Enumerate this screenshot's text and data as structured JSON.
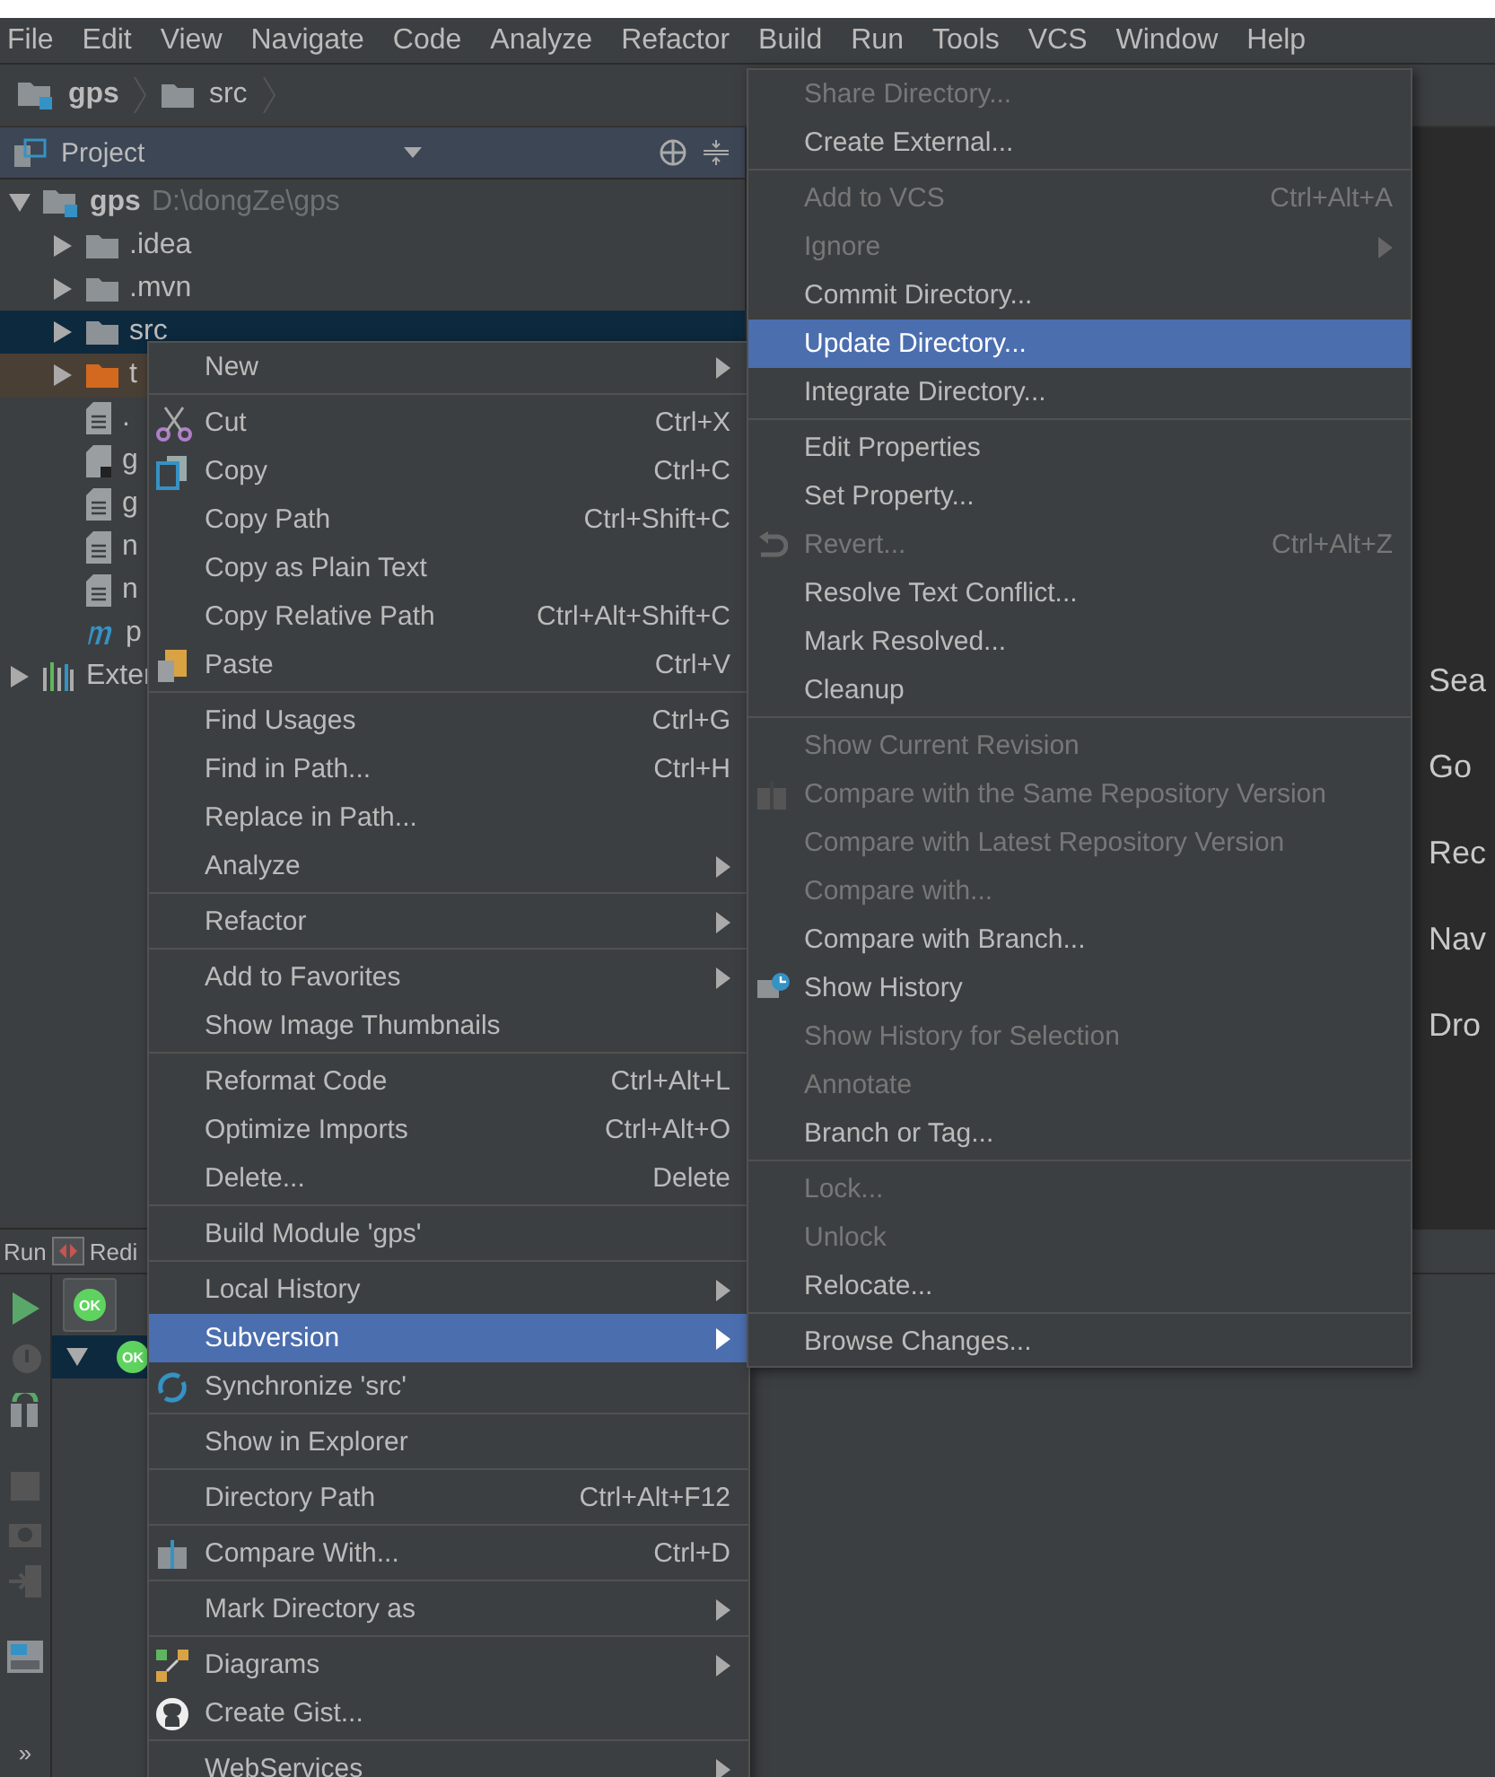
{
  "menu_bar": [
    "File",
    "Edit",
    "View",
    "Navigate",
    "Code",
    "Analyze",
    "Refactor",
    "Build",
    "Run",
    "Tools",
    "VCS",
    "Window",
    "Help"
  ],
  "breadcrumb": [
    {
      "label": "gps",
      "kind": "module"
    },
    {
      "label": "src",
      "kind": "folder"
    }
  ],
  "project_panel": {
    "title": "Project",
    "tree": [
      {
        "label": "gps",
        "path": "D:\\dongZe\\gps",
        "kind": "module",
        "expanded": true,
        "selected": false,
        "children": [
          {
            "label": ".idea",
            "kind": "folder",
            "expanded": false,
            "selected": false
          },
          {
            "label": ".mvn",
            "kind": "folder",
            "expanded": false,
            "selected": false
          },
          {
            "label": "src",
            "kind": "folder",
            "expanded": false,
            "selected": true
          },
          {
            "label": "t",
            "kind": "excluded",
            "expanded": false,
            "selected": false
          },
          {
            "label": ".",
            "kind": "file",
            "selected": false
          },
          {
            "label": "g",
            "kind": "script",
            "selected": false
          },
          {
            "label": "g",
            "kind": "file",
            "selected": false
          },
          {
            "label": "n",
            "kind": "file",
            "selected": false
          },
          {
            "label": "n",
            "kind": "file",
            "selected": false
          },
          {
            "label": "p",
            "kind": "maven",
            "selected": false
          }
        ]
      },
      {
        "label": "Exter",
        "kind": "library",
        "expanded": false,
        "selected": false
      }
    ]
  },
  "editor_hints": [
    "Sea",
    "Go",
    "Rec",
    "Nav",
    "Dro"
  ],
  "run_panel": {
    "tabs": [
      "Run",
      "Redi"
    ],
    "badges": [
      "OK",
      "OK"
    ],
    "more": "»"
  },
  "context_menu": [
    {
      "kind": "item",
      "label": "New",
      "submenu": true,
      "selected": false,
      "disabled": false
    },
    {
      "kind": "separator"
    },
    {
      "kind": "item",
      "label": "Cut",
      "shortcut": "Ctrl+X",
      "submenu": false,
      "selected": false,
      "disabled": false
    },
    {
      "kind": "item",
      "label": "Copy",
      "shortcut": "Ctrl+C",
      "submenu": false,
      "selected": false,
      "disabled": false
    },
    {
      "kind": "item",
      "label": "Copy Path",
      "shortcut": "Ctrl+Shift+C",
      "submenu": false,
      "selected": false,
      "disabled": false
    },
    {
      "kind": "item",
      "label": "Copy as Plain Text",
      "submenu": false,
      "selected": false,
      "disabled": false
    },
    {
      "kind": "item",
      "label": "Copy Relative Path",
      "shortcut": "Ctrl+Alt+Shift+C",
      "submenu": false,
      "selected": false,
      "disabled": false
    },
    {
      "kind": "item",
      "label": "Paste",
      "shortcut": "Ctrl+V",
      "submenu": false,
      "selected": false,
      "disabled": false
    },
    {
      "kind": "separator"
    },
    {
      "kind": "item",
      "label": "Find Usages",
      "shortcut": "Ctrl+G",
      "submenu": false,
      "selected": false,
      "disabled": false
    },
    {
      "kind": "item",
      "label": "Find in Path...",
      "shortcut": "Ctrl+H",
      "submenu": false,
      "selected": false,
      "disabled": false
    },
    {
      "kind": "item",
      "label": "Replace in Path...",
      "submenu": false,
      "selected": false,
      "disabled": false
    },
    {
      "kind": "item",
      "label": "Analyze",
      "submenu": true,
      "selected": false,
      "disabled": false
    },
    {
      "kind": "separator"
    },
    {
      "kind": "item",
      "label": "Refactor",
      "submenu": true,
      "selected": false,
      "disabled": false
    },
    {
      "kind": "separator"
    },
    {
      "kind": "item",
      "label": "Add to Favorites",
      "submenu": true,
      "selected": false,
      "disabled": false
    },
    {
      "kind": "item",
      "label": "Show Image Thumbnails",
      "submenu": false,
      "selected": false,
      "disabled": false
    },
    {
      "kind": "separator"
    },
    {
      "kind": "item",
      "label": "Reformat Code",
      "shortcut": "Ctrl+Alt+L",
      "submenu": false,
      "selected": false,
      "disabled": false
    },
    {
      "kind": "item",
      "label": "Optimize Imports",
      "shortcut": "Ctrl+Alt+O",
      "submenu": false,
      "selected": false,
      "disabled": false
    },
    {
      "kind": "item",
      "label": "Delete...",
      "shortcut": "Delete",
      "submenu": false,
      "selected": false,
      "disabled": false
    },
    {
      "kind": "separator"
    },
    {
      "kind": "item",
      "label": "Build Module 'gps'",
      "submenu": false,
      "selected": false,
      "disabled": false
    },
    {
      "kind": "separator"
    },
    {
      "kind": "item",
      "label": "Local History",
      "submenu": true,
      "selected": false,
      "disabled": false
    },
    {
      "kind": "item",
      "label": "Subversion",
      "submenu": true,
      "selected": true,
      "disabled": false
    },
    {
      "kind": "item",
      "label": "Synchronize 'src'",
      "submenu": false,
      "selected": false,
      "disabled": false
    },
    {
      "kind": "separator"
    },
    {
      "kind": "item",
      "label": "Show in Explorer",
      "submenu": false,
      "selected": false,
      "disabled": false
    },
    {
      "kind": "separator"
    },
    {
      "kind": "item",
      "label": "Directory Path",
      "shortcut": "Ctrl+Alt+F12",
      "submenu": false,
      "selected": false,
      "disabled": false
    },
    {
      "kind": "separator"
    },
    {
      "kind": "item",
      "label": "Compare With...",
      "shortcut": "Ctrl+D",
      "submenu": false,
      "selected": false,
      "disabled": false
    },
    {
      "kind": "separator"
    },
    {
      "kind": "item",
      "label": "Mark Directory as",
      "submenu": true,
      "selected": false,
      "disabled": false
    },
    {
      "kind": "separator"
    },
    {
      "kind": "item",
      "label": "Diagrams",
      "submenu": true,
      "selected": false,
      "disabled": false
    },
    {
      "kind": "item",
      "label": "Create Gist...",
      "submenu": false,
      "selected": false,
      "disabled": false
    },
    {
      "kind": "separator"
    },
    {
      "kind": "item",
      "label": "WebServices",
      "submenu": true,
      "selected": false,
      "disabled": false
    }
  ],
  "subversion_menu": [
    {
      "kind": "item",
      "label": "Share Directory...",
      "submenu": false,
      "selected": false,
      "disabled": true
    },
    {
      "kind": "item",
      "label": "Create External...",
      "submenu": false,
      "selected": false,
      "disabled": false
    },
    {
      "kind": "separator"
    },
    {
      "kind": "item",
      "label": "Add to VCS",
      "shortcut": "Ctrl+Alt+A",
      "submenu": false,
      "selected": false,
      "disabled": true
    },
    {
      "kind": "item",
      "label": "Ignore",
      "submenu": true,
      "selected": false,
      "disabled": true
    },
    {
      "kind": "item",
      "label": "Commit Directory...",
      "submenu": false,
      "selected": false,
      "disabled": false
    },
    {
      "kind": "item",
      "label": "Update Directory...",
      "submenu": false,
      "selected": true,
      "disabled": false
    },
    {
      "kind": "item",
      "label": "Integrate Directory...",
      "submenu": false,
      "selected": false,
      "disabled": false
    },
    {
      "kind": "separator"
    },
    {
      "kind": "item",
      "label": "Edit Properties",
      "submenu": false,
      "selected": false,
      "disabled": false
    },
    {
      "kind": "item",
      "label": "Set Property...",
      "submenu": false,
      "selected": false,
      "disabled": false
    },
    {
      "kind": "item",
      "label": "Revert...",
      "shortcut": "Ctrl+Alt+Z",
      "submenu": false,
      "selected": false,
      "disabled": true
    },
    {
      "kind": "item",
      "label": "Resolve Text Conflict...",
      "submenu": false,
      "selected": false,
      "disabled": false
    },
    {
      "kind": "item",
      "label": "Mark Resolved...",
      "submenu": false,
      "selected": false,
      "disabled": false
    },
    {
      "kind": "item",
      "label": "Cleanup",
      "submenu": false,
      "selected": false,
      "disabled": false
    },
    {
      "kind": "separator"
    },
    {
      "kind": "item",
      "label": "Show Current Revision",
      "submenu": false,
      "selected": false,
      "disabled": true
    },
    {
      "kind": "item",
      "label": "Compare with the Same Repository Version",
      "submenu": false,
      "selected": false,
      "disabled": true
    },
    {
      "kind": "item",
      "label": "Compare with Latest Repository Version",
      "submenu": false,
      "selected": false,
      "disabled": true
    },
    {
      "kind": "item",
      "label": "Compare with...",
      "submenu": false,
      "selected": false,
      "disabled": true
    },
    {
      "kind": "item",
      "label": "Compare with Branch...",
      "submenu": false,
      "selected": false,
      "disabled": false
    },
    {
      "kind": "item",
      "label": "Show History",
      "submenu": false,
      "selected": false,
      "disabled": false
    },
    {
      "kind": "item",
      "label": "Show History for Selection",
      "submenu": false,
      "selected": false,
      "disabled": true
    },
    {
      "kind": "item",
      "label": "Annotate",
      "submenu": false,
      "selected": false,
      "disabled": true
    },
    {
      "kind": "item",
      "label": "Branch or Tag...",
      "submenu": false,
      "selected": false,
      "disabled": false
    },
    {
      "kind": "separator"
    },
    {
      "kind": "item",
      "label": "Lock...",
      "submenu": false,
      "selected": false,
      "disabled": true
    },
    {
      "kind": "item",
      "label": "Unlock",
      "submenu": false,
      "selected": false,
      "disabled": true
    },
    {
      "kind": "item",
      "label": "Relocate...",
      "submenu": false,
      "selected": false,
      "disabled": false
    },
    {
      "kind": "separator"
    },
    {
      "kind": "item",
      "label": "Browse Changes...",
      "submenu": false,
      "selected": false,
      "disabled": false
    }
  ]
}
